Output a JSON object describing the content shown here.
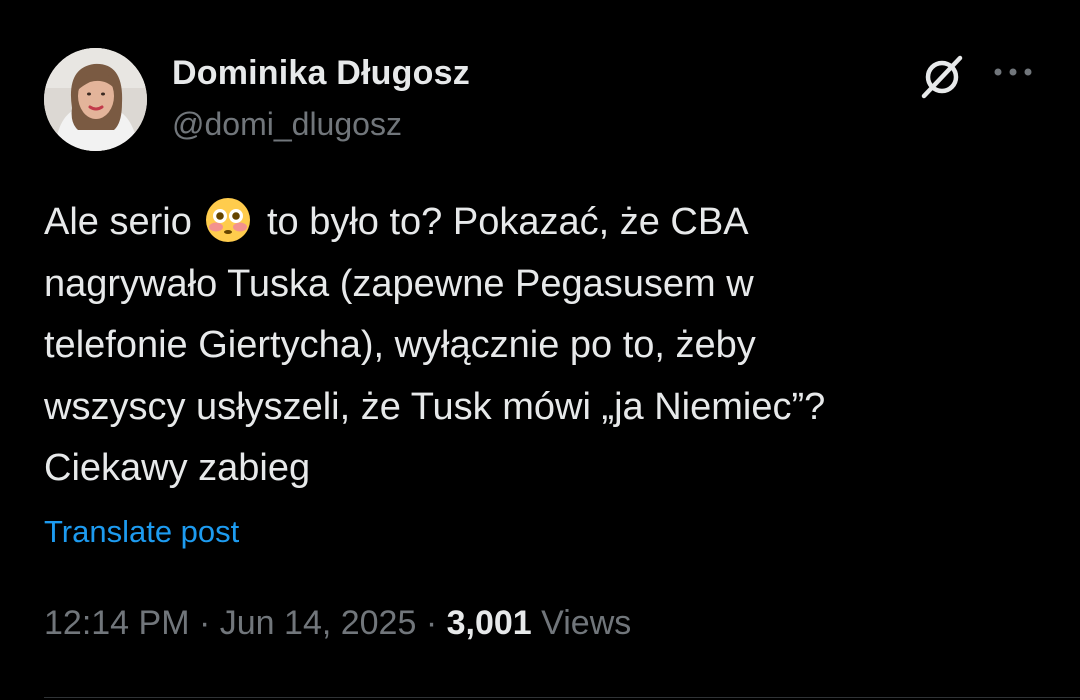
{
  "author": {
    "display_name": "Dominika Długosz",
    "handle": "@domi_dlugosz"
  },
  "header_actions": {
    "grok_icon": "grok-icon",
    "more_icon": "more-horizontal-icon"
  },
  "post": {
    "line1_before_emoji": "Ale serio",
    "emoji": "flushed-face-emoji",
    "line1_after_emoji": "to było to? Pokazać, że CBA",
    "line2": "nagrywało Tuska (zapewne Pegasusem w",
    "line3": "telefonie Giertycha), wyłącznie po to, żeby",
    "line4": "wszyscy usłyszeli, że Tusk mówi „ja Niemiec”?",
    "line5": "Ciekawy zabieg"
  },
  "translate_label": "Translate post",
  "meta": {
    "time": "12:14 PM",
    "separator": "·",
    "date": "Jun 14, 2025",
    "views_count": "3,001",
    "views_label": "Views"
  },
  "colors": {
    "background": "#000000",
    "text": "#e7e9ea",
    "muted": "#71767b",
    "link": "#1d9bf0"
  }
}
